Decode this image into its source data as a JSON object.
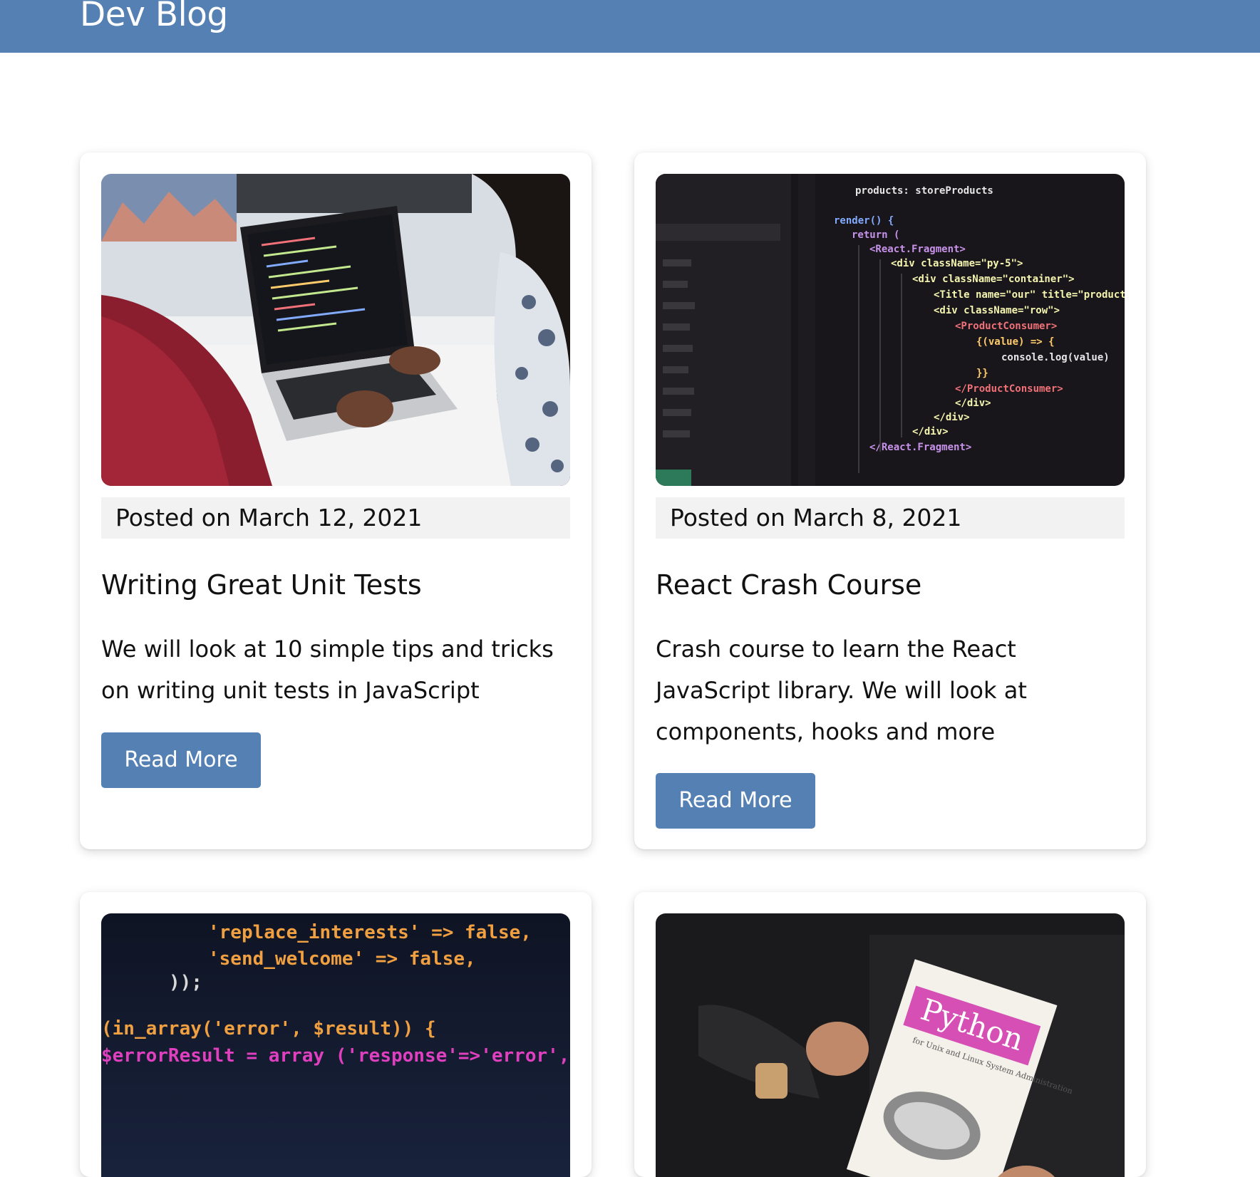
{
  "header": {
    "brand": "Dev Blog",
    "background_color": "#5580b3"
  },
  "posts": [
    {
      "image_alt": "person coding on laptop",
      "date": "Posted on March 12, 2021",
      "title": "Writing Great Unit Tests",
      "excerpt": "We will look at 10 simple tips and tricks on writing unit tests in JavaScript",
      "button_label": "Read More"
    },
    {
      "image_alt": "react code on screen",
      "date": "Posted on March 8, 2021",
      "title": "React Crash Course",
      "excerpt": "Crash course to learn the React JavaScript library. We will look at components, hooks and more",
      "button_label": "Read More"
    },
    {
      "image_alt": "php code on screen",
      "image_code_lines": [
        "'replace_interests' => false,",
        "'send_welcome'      => false,",
        "));",
        "(in_array('error', $result)) {",
        "$errorResult = array ('response'=>'error','message'"
      ]
    },
    {
      "image_alt": "person holding python book",
      "image_book_title": "Python",
      "image_book_subtitle": "for Unix and Linux System Administration"
    }
  ],
  "accent_color": "#5580b3"
}
